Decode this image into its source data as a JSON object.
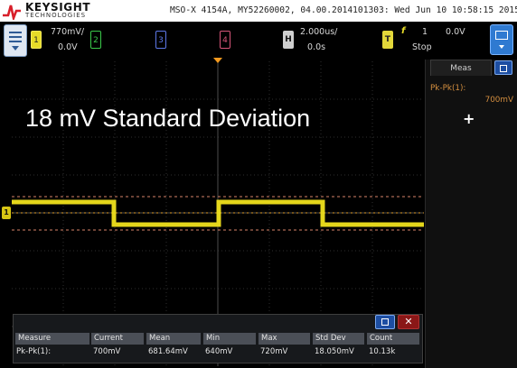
{
  "header": {
    "brand": "KEYSIGHT",
    "brand_sub": "TECHNOLOGIES",
    "instrument_info": "MSO-X 4154A, MY52260002, 04.00.2014101303: Wed Jun 10 10:58:15 2015"
  },
  "toolbar": {
    "channels": [
      {
        "number": "1",
        "scale": "770mV/",
        "offset": "0.0V",
        "color": "#e7dc28"
      },
      {
        "number": "2",
        "color": "#3ac94a"
      },
      {
        "number": "3",
        "color": "#5d78e8"
      },
      {
        "number": "4",
        "color": "#d9567a"
      }
    ],
    "horizontal": {
      "label": "H",
      "scale": "2.000us/",
      "delay": "0.0s"
    },
    "trigger": {
      "label": "T",
      "edge_symbol": "f",
      "source": "1",
      "level": "0.0V",
      "mode": "Stop"
    }
  },
  "screen": {
    "overlay_text": "18 mV Standard Deviation",
    "ground_marker": "1",
    "trace_color": "#f0e21c"
  },
  "side_panel": {
    "tab": "Meas",
    "measurement_label": "Pk-Pk(1):",
    "measurement_value": "700mV",
    "add_symbol": "+"
  },
  "measurements": {
    "columns": [
      "Measure",
      "Current",
      "Mean",
      "Min",
      "Max",
      "Std Dev",
      "Count"
    ],
    "row": [
      "Pk-Pk(1):",
      "700mV",
      "681.64mV",
      "640mV",
      "720mV",
      "18.050mV",
      "10.13k"
    ],
    "close_symbol": "✕"
  }
}
